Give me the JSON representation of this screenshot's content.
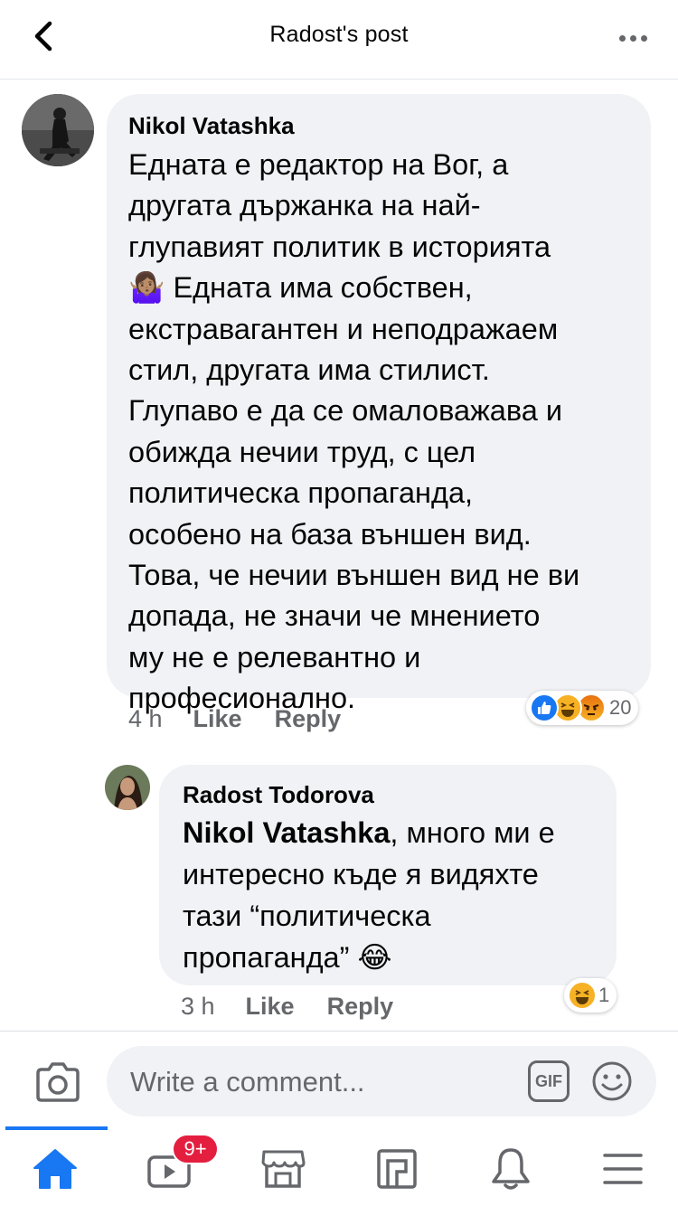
{
  "header": {
    "title": "Radost's post"
  },
  "comments": [
    {
      "author": "Nikol Vatashka",
      "lines": [
        "Едната е редактор на Вог, а",
        "другата държанка на най-",
        "глупавият политик в историята",
        "🤷🏽‍♀️ Едната има собствен,",
        "екстравагантен и неподражаем",
        "стил, другата има стилист.",
        "Глупаво е да се омаловажава и",
        "обижда нечии труд, с цел",
        "политическа пропаганда,",
        "особено на база външен вид.",
        "Това, че нечии външен вид не ви",
        "допада, не значи че мнението",
        "му не е релевантно и",
        "професионално."
      ],
      "time": "4 h",
      "like_label": "Like",
      "reply_label": "Reply",
      "reaction_icons": [
        "like-icon",
        "haha-icon",
        "angry-icon"
      ],
      "reaction_count": "20"
    }
  ],
  "reply": {
    "author": "Radost Todorova",
    "mention": "Nikol Vatashka",
    "line1_rest": ", много ми е",
    "lines": [
      "интересно къде я видяхте",
      "тази “политическа",
      "пропаганда” 😂"
    ],
    "time": "3 h",
    "like_label": "Like",
    "reply_label": "Reply",
    "reaction_icons": [
      "haha-icon"
    ],
    "reaction_count": "1"
  },
  "composer": {
    "placeholder": "Write a comment...",
    "gif_label": "GIF"
  },
  "nav": {
    "items": [
      "home-icon",
      "watch-icon",
      "marketplace-icon",
      "pages-icon",
      "notifications-icon",
      "menu-icon"
    ],
    "watch_badge": "9+",
    "active_color": "#1877f2"
  },
  "colors": {
    "bubble": "#f0f2f5",
    "secondary_text": "#65676b",
    "like_blue": "#1877f2",
    "badge_red": "#e41e3f"
  }
}
